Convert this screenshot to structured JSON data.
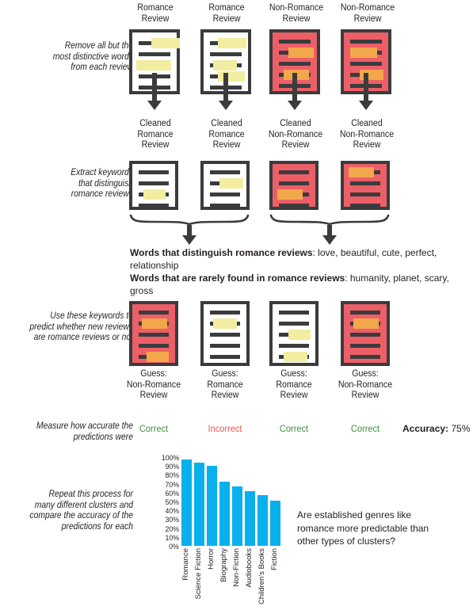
{
  "stages": {
    "step1_note": [
      "Remove all but the",
      "most distinctive words",
      "from each review"
    ],
    "step2_note": [
      "Extract keywords",
      "that distinguish",
      "romance reviews"
    ],
    "step3_note": [
      "Use these keywords to",
      "predict whether new reviews",
      "are romance reviews or not"
    ],
    "step4_note": [
      "Measure how accurate the",
      "predictions were"
    ],
    "step5_note": [
      "Repeat this process for",
      "many different clusters and",
      "compare the accuracy of the",
      "predictions for each"
    ]
  },
  "row1_labels": [
    [
      "Romance",
      "Review"
    ],
    [
      "Romance",
      "Review"
    ],
    [
      "Non-Romance",
      "Review"
    ],
    [
      "Non-Romance",
      "Review"
    ]
  ],
  "row2_labels": [
    [
      "Cleaned",
      "Romance",
      "Review"
    ],
    [
      "Cleaned",
      "Romance",
      "Review"
    ],
    [
      "Cleaned",
      "Non-Romance",
      "Review"
    ],
    [
      "Cleaned",
      "Non-Romance",
      "Review"
    ]
  ],
  "row3_labels": [
    [
      "Guess:",
      "Non-Romance",
      "Review"
    ],
    [
      "Guess:",
      "Romance",
      "Review"
    ],
    [
      "Guess:",
      "Romance",
      "Review"
    ],
    [
      "Guess:",
      "Non-Romance",
      "Review"
    ]
  ],
  "keywords": {
    "distinguish_label": "Words that distinguish romance reviews",
    "distinguish_values": ": love, beautiful, cute, perfect, relationship",
    "rare_label": "Words that are rarely found in romance reviews",
    "rare_values": ": humanity, planet, scary, gross"
  },
  "verdicts": [
    "Correct",
    "Incorrect",
    "Correct",
    "Correct"
  ],
  "accuracy": {
    "label": "Accuracy:",
    "value": " 75%"
  },
  "question": [
    "Are established genres like",
    "romance more predictable than",
    "other types of clusters?"
  ],
  "colors": {
    "romance_card": "#ffffff",
    "nonromance_card": "#ec5f67",
    "ink": "#3b3b3d",
    "highlight_yellow": "#f2eda0",
    "highlight_orange": "#f2a74b",
    "bar_blue": "#09b0ec",
    "correct_green": "#3f8f3f",
    "incorrect_red": "#e8584f"
  },
  "chart_data": {
    "type": "bar",
    "categories": [
      "Romance",
      "Science Fiction",
      "Horror",
      "Biography",
      "Non-Fiction",
      "Audiobooks",
      "Children's Books",
      "Fiction"
    ],
    "values": [
      97,
      94,
      90,
      72,
      67,
      62,
      57,
      51
    ],
    "title": "",
    "xlabel": "",
    "ylabel": "",
    "ylim": [
      0,
      100
    ],
    "yticks": [
      "100%",
      "90%",
      "80%",
      "70%",
      "60%",
      "50%",
      "40%",
      "30%",
      "20%",
      "10%",
      "0%"
    ],
    "grid": false,
    "legend": false
  }
}
